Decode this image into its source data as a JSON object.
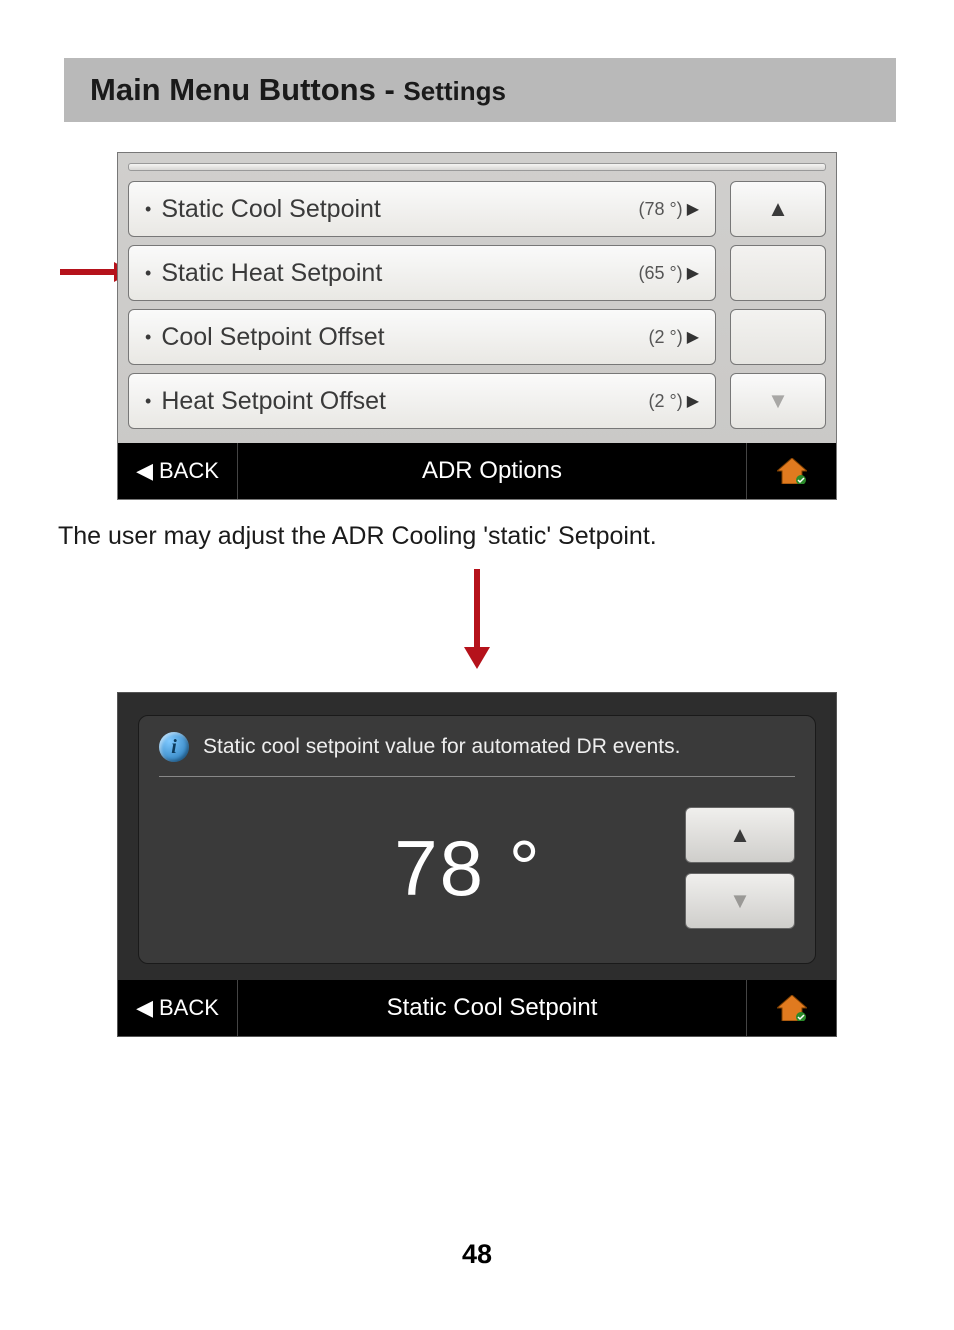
{
  "header": {
    "title": "Main Menu Buttons",
    "separator": "  -  ",
    "subtitle": "Settings"
  },
  "screen1": {
    "items": [
      {
        "label": "Static Cool Setpoint",
        "value": "(78 °)"
      },
      {
        "label": "Static Heat Setpoint",
        "value": "(65 °)"
      },
      {
        "label": "Cool Setpoint Offset",
        "value": "(2 °)"
      },
      {
        "label": "Heat Setpoint Offset",
        "value": "(2 °)"
      }
    ],
    "back": "BACK",
    "title": "ADR Options"
  },
  "caption": "The user may adjust the ADR Cooling 'static' Setpoint.",
  "screen2": {
    "info": "Static cool setpoint value for automated DR events.",
    "value": "78 °",
    "back": "BACK",
    "title": "Static Cool Setpoint"
  },
  "page": "48"
}
